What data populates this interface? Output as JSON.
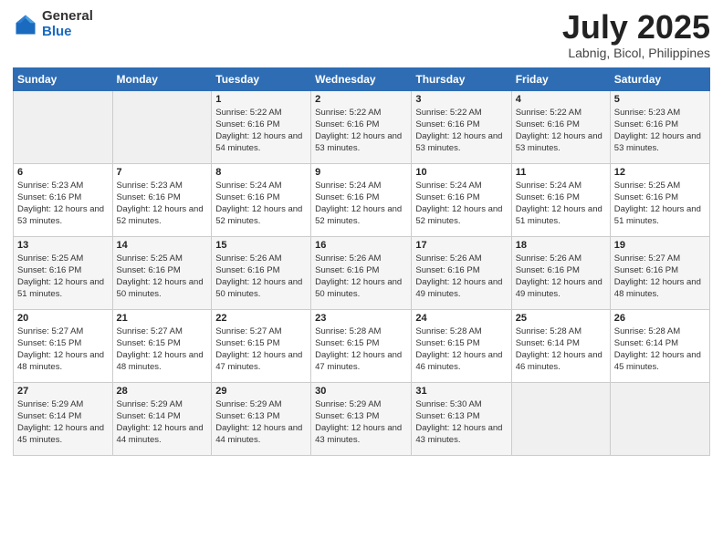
{
  "header": {
    "logo_general": "General",
    "logo_blue": "Blue",
    "title": "July 2025",
    "subtitle": "Labnig, Bicol, Philippines"
  },
  "days_of_week": [
    "Sunday",
    "Monday",
    "Tuesday",
    "Wednesday",
    "Thursday",
    "Friday",
    "Saturday"
  ],
  "weeks": [
    [
      {
        "day": "",
        "empty": true
      },
      {
        "day": "",
        "empty": true
      },
      {
        "day": "1",
        "sunrise": "Sunrise: 5:22 AM",
        "sunset": "Sunset: 6:16 PM",
        "daylight": "Daylight: 12 hours and 54 minutes."
      },
      {
        "day": "2",
        "sunrise": "Sunrise: 5:22 AM",
        "sunset": "Sunset: 6:16 PM",
        "daylight": "Daylight: 12 hours and 53 minutes."
      },
      {
        "day": "3",
        "sunrise": "Sunrise: 5:22 AM",
        "sunset": "Sunset: 6:16 PM",
        "daylight": "Daylight: 12 hours and 53 minutes."
      },
      {
        "day": "4",
        "sunrise": "Sunrise: 5:22 AM",
        "sunset": "Sunset: 6:16 PM",
        "daylight": "Daylight: 12 hours and 53 minutes."
      },
      {
        "day": "5",
        "sunrise": "Sunrise: 5:23 AM",
        "sunset": "Sunset: 6:16 PM",
        "daylight": "Daylight: 12 hours and 53 minutes."
      }
    ],
    [
      {
        "day": "6",
        "sunrise": "Sunrise: 5:23 AM",
        "sunset": "Sunset: 6:16 PM",
        "daylight": "Daylight: 12 hours and 53 minutes."
      },
      {
        "day": "7",
        "sunrise": "Sunrise: 5:23 AM",
        "sunset": "Sunset: 6:16 PM",
        "daylight": "Daylight: 12 hours and 52 minutes."
      },
      {
        "day": "8",
        "sunrise": "Sunrise: 5:24 AM",
        "sunset": "Sunset: 6:16 PM",
        "daylight": "Daylight: 12 hours and 52 minutes."
      },
      {
        "day": "9",
        "sunrise": "Sunrise: 5:24 AM",
        "sunset": "Sunset: 6:16 PM",
        "daylight": "Daylight: 12 hours and 52 minutes."
      },
      {
        "day": "10",
        "sunrise": "Sunrise: 5:24 AM",
        "sunset": "Sunset: 6:16 PM",
        "daylight": "Daylight: 12 hours and 52 minutes."
      },
      {
        "day": "11",
        "sunrise": "Sunrise: 5:24 AM",
        "sunset": "Sunset: 6:16 PM",
        "daylight": "Daylight: 12 hours and 51 minutes."
      },
      {
        "day": "12",
        "sunrise": "Sunrise: 5:25 AM",
        "sunset": "Sunset: 6:16 PM",
        "daylight": "Daylight: 12 hours and 51 minutes."
      }
    ],
    [
      {
        "day": "13",
        "sunrise": "Sunrise: 5:25 AM",
        "sunset": "Sunset: 6:16 PM",
        "daylight": "Daylight: 12 hours and 51 minutes."
      },
      {
        "day": "14",
        "sunrise": "Sunrise: 5:25 AM",
        "sunset": "Sunset: 6:16 PM",
        "daylight": "Daylight: 12 hours and 50 minutes."
      },
      {
        "day": "15",
        "sunrise": "Sunrise: 5:26 AM",
        "sunset": "Sunset: 6:16 PM",
        "daylight": "Daylight: 12 hours and 50 minutes."
      },
      {
        "day": "16",
        "sunrise": "Sunrise: 5:26 AM",
        "sunset": "Sunset: 6:16 PM",
        "daylight": "Daylight: 12 hours and 50 minutes."
      },
      {
        "day": "17",
        "sunrise": "Sunrise: 5:26 AM",
        "sunset": "Sunset: 6:16 PM",
        "daylight": "Daylight: 12 hours and 49 minutes."
      },
      {
        "day": "18",
        "sunrise": "Sunrise: 5:26 AM",
        "sunset": "Sunset: 6:16 PM",
        "daylight": "Daylight: 12 hours and 49 minutes."
      },
      {
        "day": "19",
        "sunrise": "Sunrise: 5:27 AM",
        "sunset": "Sunset: 6:16 PM",
        "daylight": "Daylight: 12 hours and 48 minutes."
      }
    ],
    [
      {
        "day": "20",
        "sunrise": "Sunrise: 5:27 AM",
        "sunset": "Sunset: 6:15 PM",
        "daylight": "Daylight: 12 hours and 48 minutes."
      },
      {
        "day": "21",
        "sunrise": "Sunrise: 5:27 AM",
        "sunset": "Sunset: 6:15 PM",
        "daylight": "Daylight: 12 hours and 48 minutes."
      },
      {
        "day": "22",
        "sunrise": "Sunrise: 5:27 AM",
        "sunset": "Sunset: 6:15 PM",
        "daylight": "Daylight: 12 hours and 47 minutes."
      },
      {
        "day": "23",
        "sunrise": "Sunrise: 5:28 AM",
        "sunset": "Sunset: 6:15 PM",
        "daylight": "Daylight: 12 hours and 47 minutes."
      },
      {
        "day": "24",
        "sunrise": "Sunrise: 5:28 AM",
        "sunset": "Sunset: 6:15 PM",
        "daylight": "Daylight: 12 hours and 46 minutes."
      },
      {
        "day": "25",
        "sunrise": "Sunrise: 5:28 AM",
        "sunset": "Sunset: 6:14 PM",
        "daylight": "Daylight: 12 hours and 46 minutes."
      },
      {
        "day": "26",
        "sunrise": "Sunrise: 5:28 AM",
        "sunset": "Sunset: 6:14 PM",
        "daylight": "Daylight: 12 hours and 45 minutes."
      }
    ],
    [
      {
        "day": "27",
        "sunrise": "Sunrise: 5:29 AM",
        "sunset": "Sunset: 6:14 PM",
        "daylight": "Daylight: 12 hours and 45 minutes."
      },
      {
        "day": "28",
        "sunrise": "Sunrise: 5:29 AM",
        "sunset": "Sunset: 6:14 PM",
        "daylight": "Daylight: 12 hours and 44 minutes."
      },
      {
        "day": "29",
        "sunrise": "Sunrise: 5:29 AM",
        "sunset": "Sunset: 6:13 PM",
        "daylight": "Daylight: 12 hours and 44 minutes."
      },
      {
        "day": "30",
        "sunrise": "Sunrise: 5:29 AM",
        "sunset": "Sunset: 6:13 PM",
        "daylight": "Daylight: 12 hours and 43 minutes."
      },
      {
        "day": "31",
        "sunrise": "Sunrise: 5:30 AM",
        "sunset": "Sunset: 6:13 PM",
        "daylight": "Daylight: 12 hours and 43 minutes."
      },
      {
        "day": "",
        "empty": true
      },
      {
        "day": "",
        "empty": true
      }
    ]
  ]
}
